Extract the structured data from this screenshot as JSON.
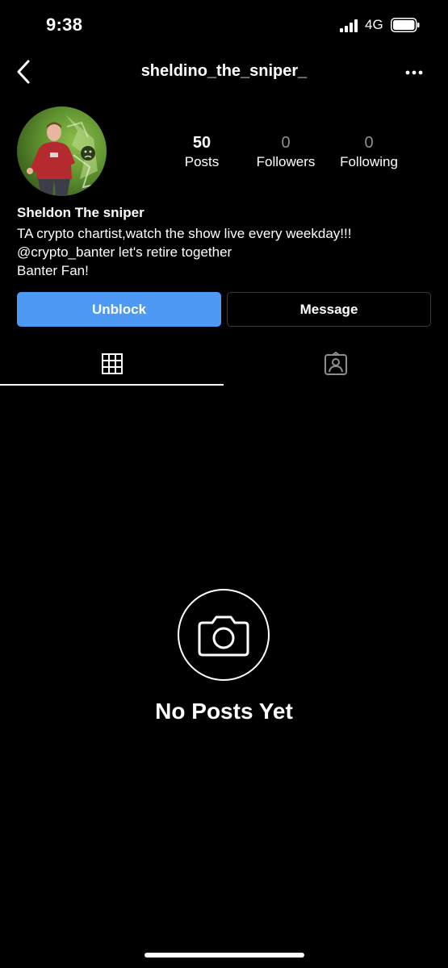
{
  "status_bar": {
    "time": "9:38",
    "network": "4G",
    "icons": [
      "signal-icon",
      "battery-icon"
    ]
  },
  "header": {
    "username": "sheldino_the_sniper_",
    "icons": [
      "back-chevron-icon",
      "more-options-icon"
    ]
  },
  "profile": {
    "stats": [
      {
        "value": "50",
        "label": "Posts"
      },
      {
        "value": "0",
        "label": "Followers"
      },
      {
        "value": "0",
        "label": "Following"
      }
    ],
    "display_name": "Sheldon The sniper",
    "bio_lines": [
      "TA crypto chartist,watch the show live every weekday!!!",
      "@crypto_banter let's retire together",
      "Banter Fan!"
    ]
  },
  "actions": {
    "unblock_label": "Unblock",
    "message_label": "Message"
  },
  "tabs": {
    "items": [
      "grid-icon",
      "tagged-icon"
    ],
    "active": 0
  },
  "empty_state": {
    "icon": "camera-icon",
    "title": "No Posts Yet"
  },
  "colors": {
    "accent": "#4d99f3",
    "background": "#000000",
    "muted": "#8e8e8e"
  }
}
